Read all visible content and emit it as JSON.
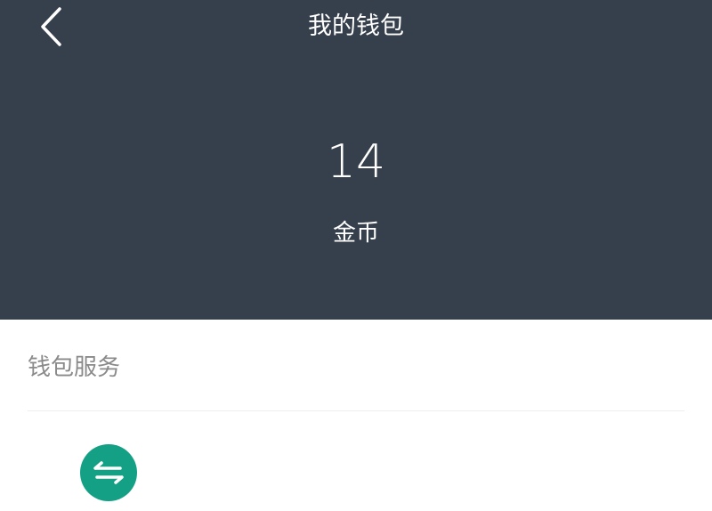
{
  "header": {
    "title": "我的钱包",
    "back_icon": "chevron-left-icon",
    "background_color": "#363f4c"
  },
  "balance": {
    "value": "14",
    "unit": "金币"
  },
  "services": {
    "section_title": "钱包服务",
    "items": [
      {
        "icon": "exchange-arrows-icon",
        "icon_color": "#13a084"
      }
    ]
  }
}
